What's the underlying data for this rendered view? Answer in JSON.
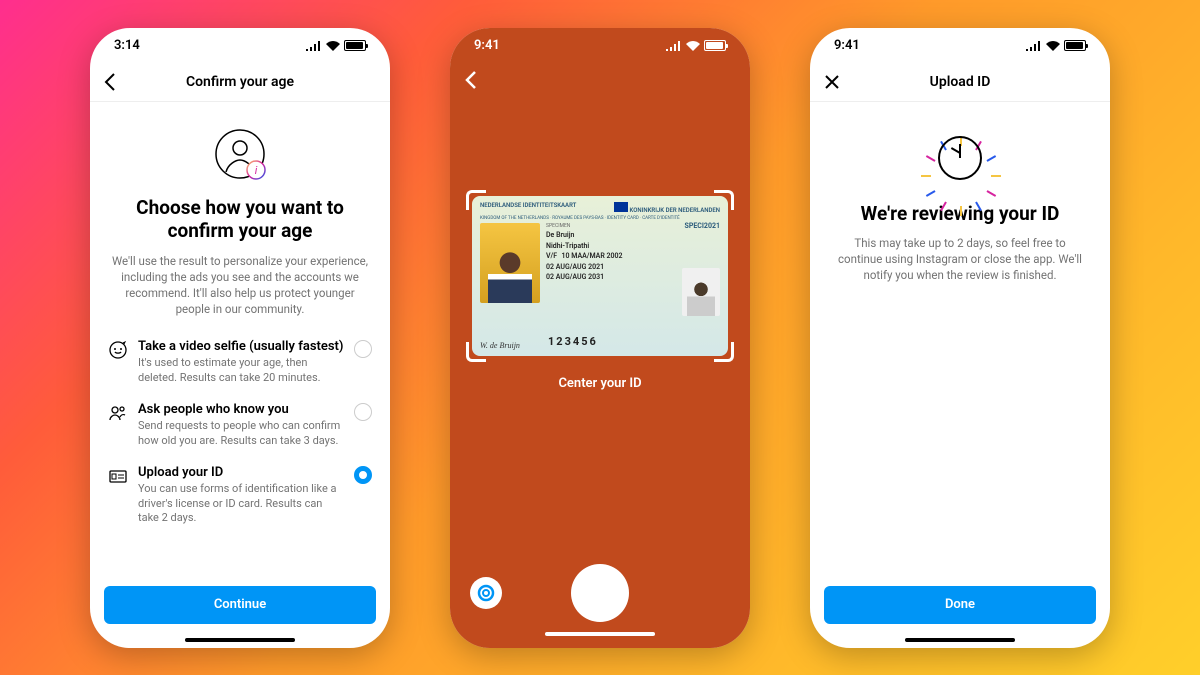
{
  "phone1": {
    "time": "3:14",
    "nav_title": "Confirm your age",
    "heading": "Choose how you want to confirm your age",
    "subtext": "We'll use the result to personalize your experience, including the ads you see and the accounts we recommend. It'll also help us protect younger people in our community.",
    "options": [
      {
        "title": "Take a video selfie (usually fastest)",
        "desc": "It's used to estimate your age, then deleted. Results can take 20 minutes.",
        "selected": false
      },
      {
        "title": "Ask people who know you",
        "desc": "Send requests to people who can confirm how old you are. Results can take 3 days.",
        "selected": false
      },
      {
        "title": "Upload your ID",
        "desc": "You can use forms of identification like a driver's license or ID card. Results can take 2 days.",
        "selected": true
      }
    ],
    "button": "Continue"
  },
  "phone2": {
    "time": "9:41",
    "instruction": "Center your ID",
    "id_card": {
      "header_left": "NEDERLANDSE IDENTITEITSKAART",
      "header_right": "KONINKRIJK DER NEDERLANDEN",
      "header_sub": "KINGDOM OF THE NETHERLANDS · ROYAUME DES PAYS-BAS · IDENTITY CARD · CARTE D'IDENTITÉ",
      "surname": "De Bruijn",
      "given": "Nidhi-Tripathi",
      "sex": "V/F",
      "dob": "10 MAA/MAR 2002",
      "issue": "02 AUG/AUG 2021",
      "expiry": "02 AUG/AUG 2031",
      "number": "123456",
      "specimen": "SPECIMEN",
      "code": "SPECI2021"
    }
  },
  "phone3": {
    "time": "9:41",
    "nav_title": "Upload ID",
    "heading": "We're reviewing your ID",
    "subtext": "This may take up to 2 days, so feel free to continue using Instagram or close the app. We'll notify you when the review is finished.",
    "button": "Done"
  }
}
